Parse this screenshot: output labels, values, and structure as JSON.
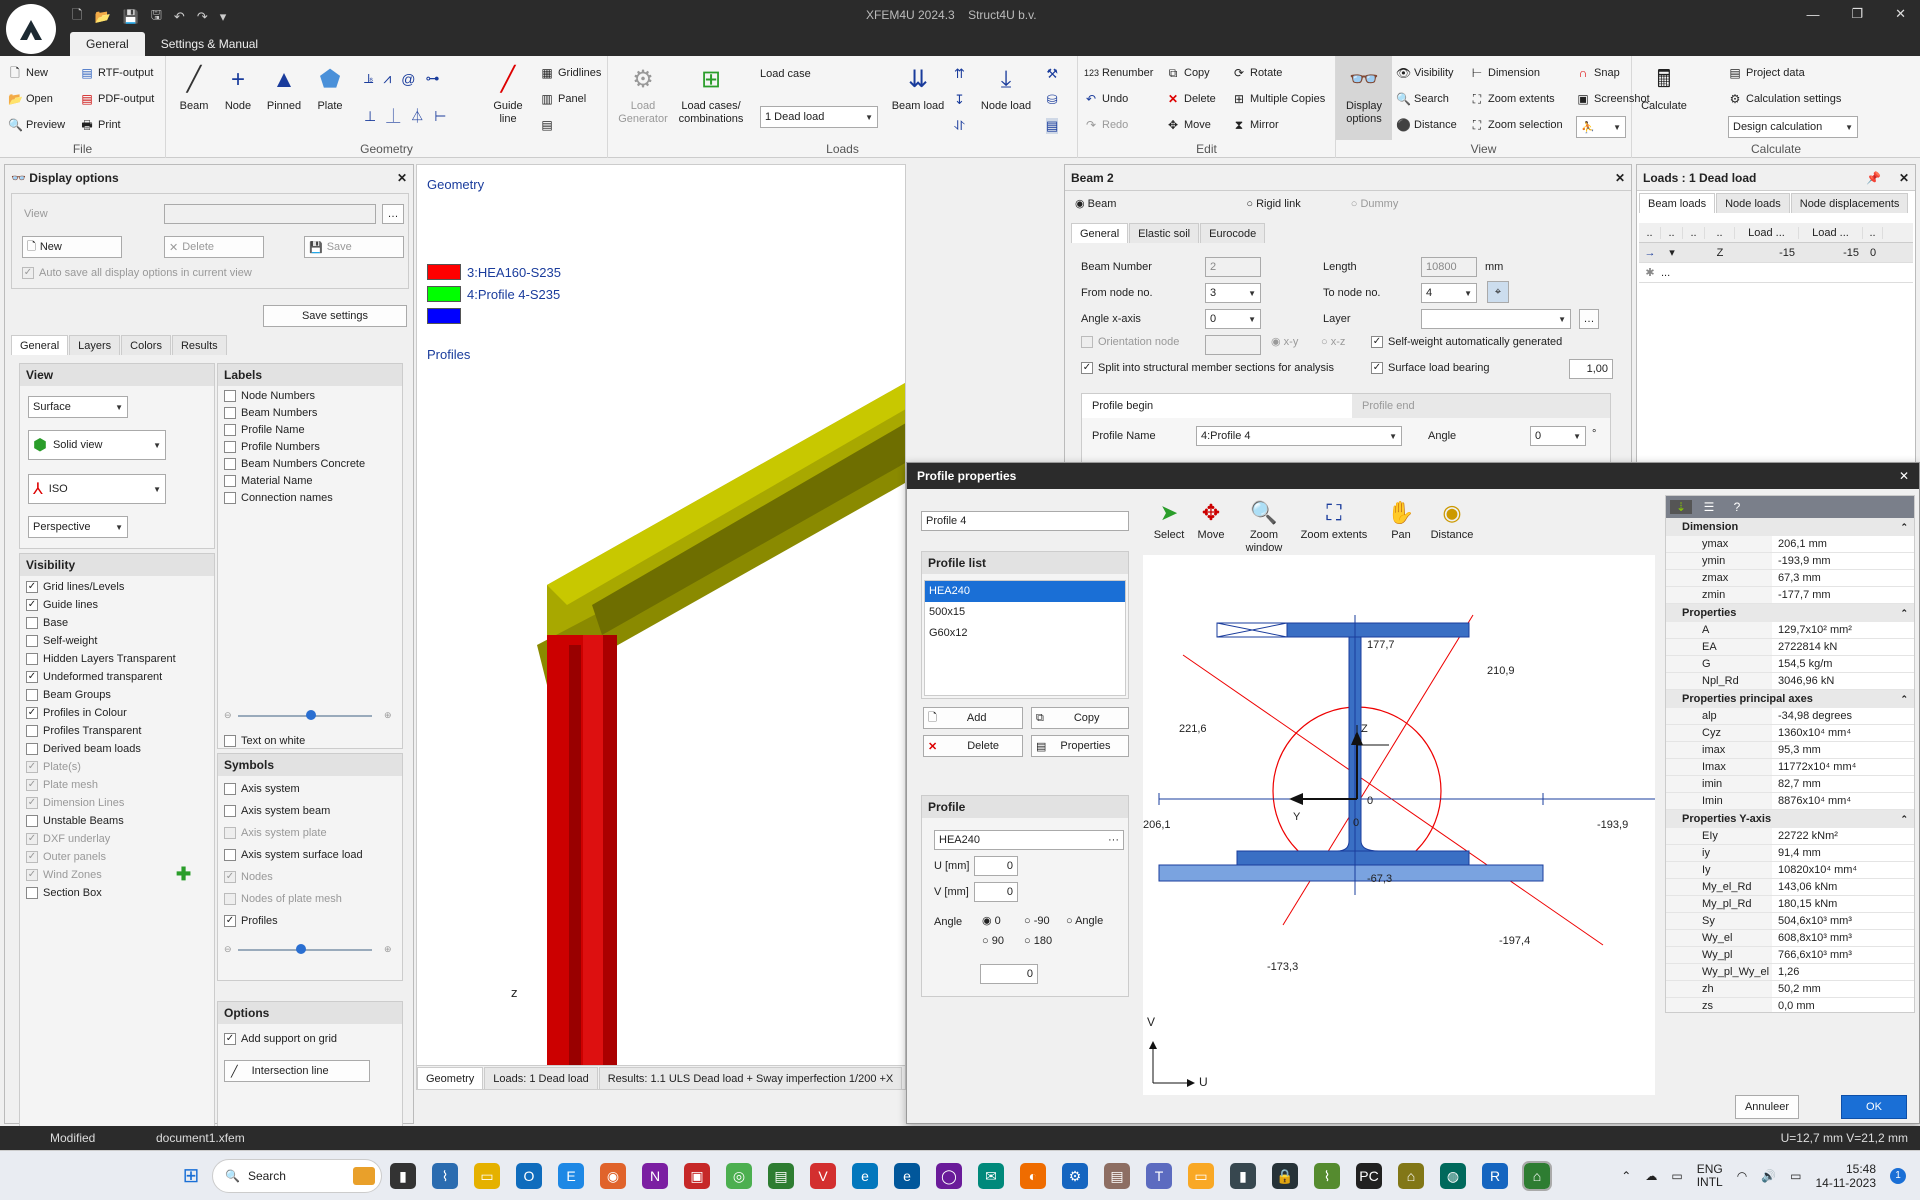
{
  "app": {
    "title": "XFEM4U 2024.3",
    "company": "Struct4U b.v."
  },
  "ribbon_tabs": [
    "General",
    "Settings & Manual"
  ],
  "ribbon": {
    "file": {
      "name": "File",
      "new": "New",
      "open": "Open",
      "preview": "Preview",
      "rtf": "RTF-output",
      "pdf": "PDF-output",
      "print": "Print"
    },
    "geometry": {
      "name": "Geometry",
      "beam": "Beam",
      "node": "Node",
      "pinned": "Pinned",
      "plate": "Plate",
      "guide": "Guide line",
      "gridlines": "Gridlines",
      "panel": "Panel"
    },
    "loads": {
      "name": "Loads",
      "generator": "Load Generator",
      "cases": "Load cases/ combinations",
      "loadcase_label": "Load case",
      "loadcase_value": "1 Dead load",
      "beam_load": "Beam load",
      "node_load": "Node load"
    },
    "edit": {
      "name": "Edit",
      "renumber": "Renumber",
      "undo": "Undo",
      "redo": "Redo",
      "copy": "Copy",
      "delete": "Delete",
      "move": "Move",
      "rotate": "Rotate",
      "multiple": "Multiple Copies",
      "mirror": "Mirror"
    },
    "view": {
      "name": "View",
      "display": "Display options",
      "visibility": "Visibility",
      "search": "Search",
      "distance": "Distance",
      "dimension": "Dimension",
      "zoom_extents": "Zoom extents",
      "zoom_selection": "Zoom selection",
      "snap": "Snap",
      "screenshot": "Screenshot"
    },
    "calculate": {
      "name": "Calculate",
      "calculate": "Calculate",
      "project": "Project data",
      "settings": "Calculation settings",
      "design": "Design calculation"
    }
  },
  "display_options": {
    "title": "Display options",
    "view_label": "View",
    "new": "New",
    "delete": "Delete",
    "save": "Save",
    "autosave": "Auto save all display options in current view",
    "save_settings": "Save settings",
    "tabs": [
      "General",
      "Layers",
      "Colors",
      "Results"
    ],
    "view_box": {
      "title": "View",
      "surface": "Surface",
      "solid": "Solid view",
      "iso": "ISO",
      "perspective": "Perspective"
    },
    "visibility": {
      "title": "Visibility",
      "items": [
        {
          "label": "Grid lines/Levels",
          "on": true,
          "dis": false
        },
        {
          "label": "Guide lines",
          "on": true,
          "dis": false
        },
        {
          "label": "Base",
          "on": false,
          "dis": false
        },
        {
          "label": "Self-weight",
          "on": false,
          "dis": false
        },
        {
          "label": "Hidden Layers Transparent",
          "on": false,
          "dis": false
        },
        {
          "label": "Undeformed transparent",
          "on": true,
          "dis": false
        },
        {
          "label": "Beam Groups",
          "on": false,
          "dis": false
        },
        {
          "label": "Profiles in Colour",
          "on": true,
          "dis": false
        },
        {
          "label": "Profiles Transparent",
          "on": false,
          "dis": false
        },
        {
          "label": "Derived beam loads",
          "on": false,
          "dis": false
        },
        {
          "label": "Plate(s)",
          "on": true,
          "dis": true
        },
        {
          "label": "Plate mesh",
          "on": true,
          "dis": true
        },
        {
          "label": "Dimension Lines",
          "on": true,
          "dis": true
        },
        {
          "label": "Unstable Beams",
          "on": false,
          "dis": false
        },
        {
          "label": "DXF underlay",
          "on": true,
          "dis": true
        },
        {
          "label": "Outer panels",
          "on": true,
          "dis": true
        },
        {
          "label": "Wind Zones",
          "on": true,
          "dis": true
        },
        {
          "label": "Section Box",
          "on": false,
          "dis": false
        }
      ]
    },
    "labels": {
      "title": "Labels",
      "items": [
        {
          "label": "Node Numbers",
          "on": false
        },
        {
          "label": "Beam Numbers",
          "on": false
        },
        {
          "label": "Profile Name",
          "on": false
        },
        {
          "label": "Profile Numbers",
          "on": false
        },
        {
          "label": "Beam Numbers Concrete",
          "on": false
        },
        {
          "label": "Material Name",
          "on": false
        },
        {
          "label": "Connection names",
          "on": false
        }
      ],
      "text_on_white": "Text on white"
    },
    "symbols": {
      "title": "Symbols",
      "items": [
        {
          "label": "Axis system",
          "on": false,
          "dis": false
        },
        {
          "label": "Axis system beam",
          "on": false,
          "dis": false
        },
        {
          "label": "Axis system plate",
          "on": false,
          "dis": true
        },
        {
          "label": "Axis system surface load",
          "on": false,
          "dis": false
        },
        {
          "label": "Nodes",
          "on": true,
          "dis": true
        },
        {
          "label": "Nodes of plate mesh",
          "on": false,
          "dis": true
        },
        {
          "label": "Profiles",
          "on": true,
          "dis": false
        }
      ]
    },
    "options": {
      "title": "Options",
      "add_support": "Add support on grid",
      "intersection": "Intersection line"
    }
  },
  "viewport": {
    "title": "Geometry",
    "legend": [
      {
        "label": "3:HEA160-S235",
        "color": "#ff0000"
      },
      {
        "label": "4:Profile 4-S235",
        "color": "#00ff00"
      },
      {
        "label": "",
        "color": "#0000ff"
      }
    ],
    "profiles": "Profiles",
    "bottom_tabs": [
      "Geometry",
      "Loads: 1 Dead load",
      "Results: 1.1 ULS  Dead load + Sway imperfection 1/200 +X"
    ]
  },
  "beam": {
    "title": "Beam 2",
    "types": [
      "Beam",
      "Rigid link",
      "Dummy"
    ],
    "tabs": [
      "General",
      "Elastic soil",
      "Eurocode"
    ],
    "beam_number_label": "Beam Number",
    "beam_number": "2",
    "length_label": "Length",
    "length": "10800",
    "unit": "mm",
    "from_label": "From node no.",
    "from": "3",
    "to_label": "To node no.",
    "to": "4",
    "angle_label": "Angle x-axis",
    "angle": "0",
    "layer_label": "Layer",
    "orientation": "Orientation node",
    "xy": "x-y",
    "xz": "x-z",
    "selfweight": "Self-weight automatically generated",
    "split": "Split into structural member sections for analysis",
    "surface": "Surface load bearing",
    "surface_val": "1,00",
    "profile_begin": "Profile begin",
    "profile_end": "Profile end",
    "profile_name_label": "Profile Name",
    "profile_name": "4:Profile 4",
    "angle2_label": "Angle",
    "angle2": "0",
    "deg": "°"
  },
  "loads_panel": {
    "title": "Loads : 1 Dead load",
    "tabs": [
      "Beam loads",
      "Node loads",
      "Node displacements"
    ],
    "headers": [
      "..",
      "..",
      "..",
      "..",
      "Load ...",
      "Load ...",
      ".."
    ],
    "row": [
      "",
      "Z",
      "-15",
      "-15",
      "0"
    ],
    "new_row": "..."
  },
  "profile_props": {
    "title": "Profile properties",
    "name": "Profile 4",
    "tools": [
      "Select",
      "Move",
      "Zoom window",
      "Zoom extents",
      "Pan",
      "Distance"
    ],
    "list_title": "Profile list",
    "list": [
      "HEA240",
      "500x15",
      "G60x12"
    ],
    "add": "Add",
    "copy": "Copy",
    "delete": "Delete",
    "properties": "Properties",
    "profile_title": "Profile",
    "profile_value": "HEA240",
    "u_label": "U [mm]",
    "u": "0",
    "v_label": "V [mm]",
    "v": "0",
    "angle_label": "Angle",
    "angles": [
      "0",
      "-90",
      "Angle",
      "90",
      "180"
    ],
    "angle_val": "0",
    "cancel": "Annuleer",
    "ok": "OK",
    "dims": {
      "top": "177,7",
      "tr": "210,9",
      "tl": "221,6",
      "left": "206,1",
      "right": "-193,9",
      "bot": "-67,3",
      "br": "-197,4",
      "bl": "-173,3",
      "origin": "0",
      "origin2": "0",
      "y": "Y",
      "z": "Z",
      "v": "V",
      "u": "U"
    },
    "sections": [
      {
        "title": "Dimension",
        "rows": [
          [
            "ymax",
            "206,1 mm"
          ],
          [
            "ymin",
            "-193,9 mm"
          ],
          [
            "zmax",
            "67,3 mm"
          ],
          [
            "zmin",
            "-177,7 mm"
          ]
        ]
      },
      {
        "title": "Properties",
        "rows": [
          [
            "A",
            "129,7x10² mm²"
          ],
          [
            "EA",
            "2722814 kN"
          ],
          [
            "G",
            "154,5 kg/m"
          ],
          [
            "Npl_Rd",
            "3046,96 kN"
          ]
        ]
      },
      {
        "title": "Properties principal axes",
        "rows": [
          [
            "alp",
            "-34,98 degrees"
          ],
          [
            "Cyz",
            "1360x10⁴ mm⁴"
          ],
          [
            "imax",
            "95,3 mm"
          ],
          [
            "Imax",
            "11772x10⁴ mm⁴"
          ],
          [
            "imin",
            "82,7 mm"
          ],
          [
            "Imin",
            "8876x10⁴ mm⁴"
          ]
        ]
      },
      {
        "title": "Properties Y-axis",
        "rows": [
          [
            "EIy",
            "22722 kNm²"
          ],
          [
            "iy",
            "91,4 mm"
          ],
          [
            "Iy",
            "10820x10⁴ mm⁴"
          ],
          [
            "My_el_Rd",
            "143,06 kNm"
          ],
          [
            "My_pl_Rd",
            "180,15 kNm"
          ],
          [
            "Sy",
            "504,6x10³ mm³"
          ],
          [
            "Wy_el",
            "608,8x10³ mm³"
          ],
          [
            "Wy_pl",
            "766,6x10³ mm³"
          ],
          [
            "Wy_pl_Wy_el",
            "1,26"
          ],
          [
            "zh",
            "50,2 mm"
          ],
          [
            "zs",
            "0,0 mm"
          ]
        ]
      }
    ]
  },
  "status": {
    "modified": "Modified",
    "doc": "document1.xfem",
    "coords": "U=12,7 mm V=21,2 mm"
  },
  "taskbar": {
    "search": "Search",
    "lang1": "ENG",
    "lang2": "INTL",
    "time": "15:48",
    "date": "14-11-2023",
    "notif": "1"
  }
}
